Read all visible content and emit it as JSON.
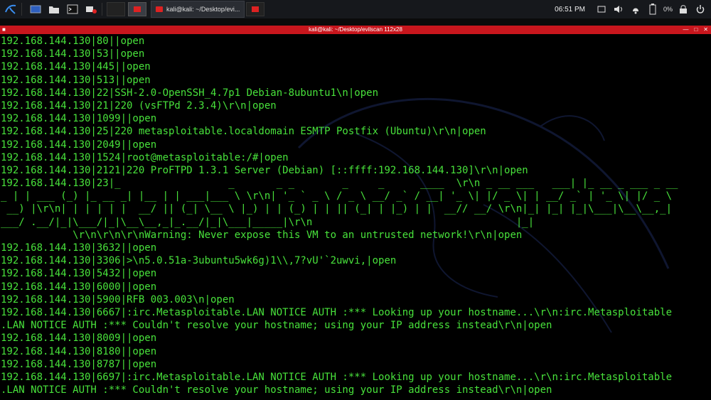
{
  "taskbar": {
    "icons": [
      "kali-menu-icon",
      "desktop-icon",
      "folder-icon",
      "terminal-icon",
      "video-record-icon"
    ],
    "workspaces": [
      "1",
      "2"
    ],
    "tasks": [
      {
        "label": "kali@kali: ~/Desktop/evi..."
      }
    ],
    "clock": "06:51 PM",
    "battery": "0%"
  },
  "window": {
    "title": "kali@kali: ~/Desktop/evilscan 112x28"
  },
  "terminal": {
    "lines": [
      "192.168.144.130|80||open",
      "192.168.144.130|53||open",
      "192.168.144.130|445||open",
      "192.168.144.130|513||open",
      "192.168.144.130|22|SSH-2.0-OpenSSH_4.7p1 Debian-8ubuntu1\\n|open",
      "192.168.144.130|21|220 (vsFTPd 2.3.4)\\r\\n|open",
      "192.168.144.130|1099||open",
      "192.168.144.130|25|220 metasploitable.localdomain ESMTP Postfix (Ubuntu)\\r\\n|open",
      "192.168.144.130|2049||open",
      "192.168.144.130|1524|root@metasploitable:/#|open",
      "192.168.144.130|2121|220 ProFTPD 1.3.1 Server (Debian) [::ffff:192.168.144.130]\\r\\n|open",
      "192.168.144.130|23|_                  _       _ _        _     _      ____  \\r\\n _ __ ___   ___| |_ __ _ ___ _ __",
      "_ | | ___ (_) |_ __ _| |__ | | ___|___ \\ \\r\\n| '_ ` _ \\ / _ \\ __/ _` / __| '_ \\| |/ _ \\| | __/ _` | '_ \\| |/ _ \\",
      " __) |\\r\\n| | | | | |  __/ || (_| \\__ \\ |_) | | (_) | | || (_| | |_) | |  __// __/ \\r\\n|_| |_| |_|\\___|\\__\\__,_|",
      "___/ .__/|_|\\___/|_|\\__\\__,_|_.__/|_|\\___|_____|\\r\\n                                  |_|",
      "            \\r\\n\\r\\n\\r\\nWarning: Never expose this VM to an untrusted network!\\r\\n|open",
      "192.168.144.130|3632||open",
      "192.168.144.130|3306|>\\n5.0.51a-3ubuntu5wk6g)1\\\\,7?vU'`2uwvi,|open",
      "192.168.144.130|5432||open",
      "192.168.144.130|6000||open",
      "192.168.144.130|5900|RFB 003.003\\n|open",
      "192.168.144.130|6667|:irc.Metasploitable.LAN NOTICE AUTH :*** Looking up your hostname...\\r\\n:irc.Metasploitable",
      ".LAN NOTICE AUTH :*** Couldn't resolve your hostname; using your IP address instead\\r\\n|open",
      "192.168.144.130|8009||open",
      "192.168.144.130|8180||open",
      "192.168.144.130|8787||open",
      "192.168.144.130|6697|:irc.Metasploitable.LAN NOTICE AUTH :*** Looking up your hostname...\\r\\n:irc.Metasploitable",
      ".LAN NOTICE AUTH :*** Couldn't resolve your hostname; using your IP address instead\\r\\n|open"
    ]
  },
  "colors": {
    "terminal_text": "#48e23b",
    "titlebar": "#c8161d",
    "taskbar": "#16181c"
  }
}
